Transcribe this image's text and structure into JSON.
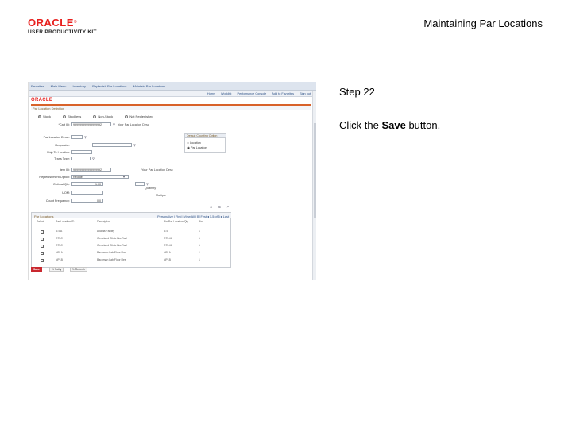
{
  "slide": {
    "logo_brand": "ORACLE",
    "logo_reg": "®",
    "logo_product": "USER PRODUCTIVITY KIT",
    "title": "Maintaining Par Locations",
    "step": "Step 22",
    "instruction_prefix": "Click the ",
    "instruction_bold": "Save",
    "instruction_suffix": " button."
  },
  "screenshot": {
    "breadcrumbs": [
      "Favorites",
      "Main Menu",
      "Inventory",
      "Replenish Par Locations",
      "Maintain Par Locations"
    ],
    "subnav_links": [
      "Home",
      "Worklist",
      "Performance Console",
      "Add to Favorites",
      "Sign out"
    ],
    "oracle_mark": "ORACLE",
    "page_title": "Par Location Definition",
    "radio_options": [
      {
        "label": "Stock",
        "selected": true
      },
      {
        "label": "Stockless",
        "selected": false
      },
      {
        "label": "Non-Stock",
        "selected": false
      },
      {
        "label": "Not Replenished",
        "selected": false
      }
    ],
    "labels": {
      "cart_id": "*Cart ID:",
      "cart_descr": "Par Location Descr:",
      "requester": "Requester:",
      "ship_to": "Ship To Location:",
      "trans_type": "Trans Type:",
      "item_id": "Item ID:",
      "replenish_option": "Replenishment Option:",
      "optimal_qty": "Optimal Qty:",
      "uom": "UOM:",
      "count_freq": "Count Frequency:"
    },
    "values": {
      "cart_id": "999999999999999992",
      "item_id": "999999999999999992",
      "replenish_option": "Reorder",
      "optimal_qty": "1.00",
      "count_freq": "0.0"
    },
    "side_notes": {
      "cart_note": "Your Par Location Desc",
      "item_note": "Your Par Location Desc",
      "unit1": "Quantity",
      "unit2": "Multiple"
    },
    "copy_box": {
      "title": "Default Counting Option",
      "options": [
        "Location",
        "Par Location"
      ]
    },
    "grid": {
      "title": "Par Locations",
      "nav": "Personalize | Find | View All | ▤ First ◂ 1-5 of 5 ▸ Last",
      "columns": [
        "Select",
        "Par Location ID",
        "Description",
        "Bin Par Location Qty",
        "Bin"
      ],
      "rows": [
        [
          "",
          "ATLA",
          "Atlanta Facility",
          "ATL",
          "1"
        ],
        [
          "",
          "CTLC",
          "Cleveland Clinic Bio-Rad",
          "CTL-M",
          "1"
        ],
        [
          "",
          "CTLC",
          "Cleveland Clinic Bio-Rad",
          "CTL-M",
          "1"
        ],
        [
          "",
          "NPLA",
          "Bachman Lab Floor Rad",
          "NPLA",
          "1"
        ],
        [
          "",
          "NPLB",
          "Bachman Lab Floor Res",
          "NPLB",
          "1"
        ]
      ]
    },
    "buttons": {
      "save": "Save",
      "notify": "Notify",
      "refresh": "Refresh"
    }
  }
}
